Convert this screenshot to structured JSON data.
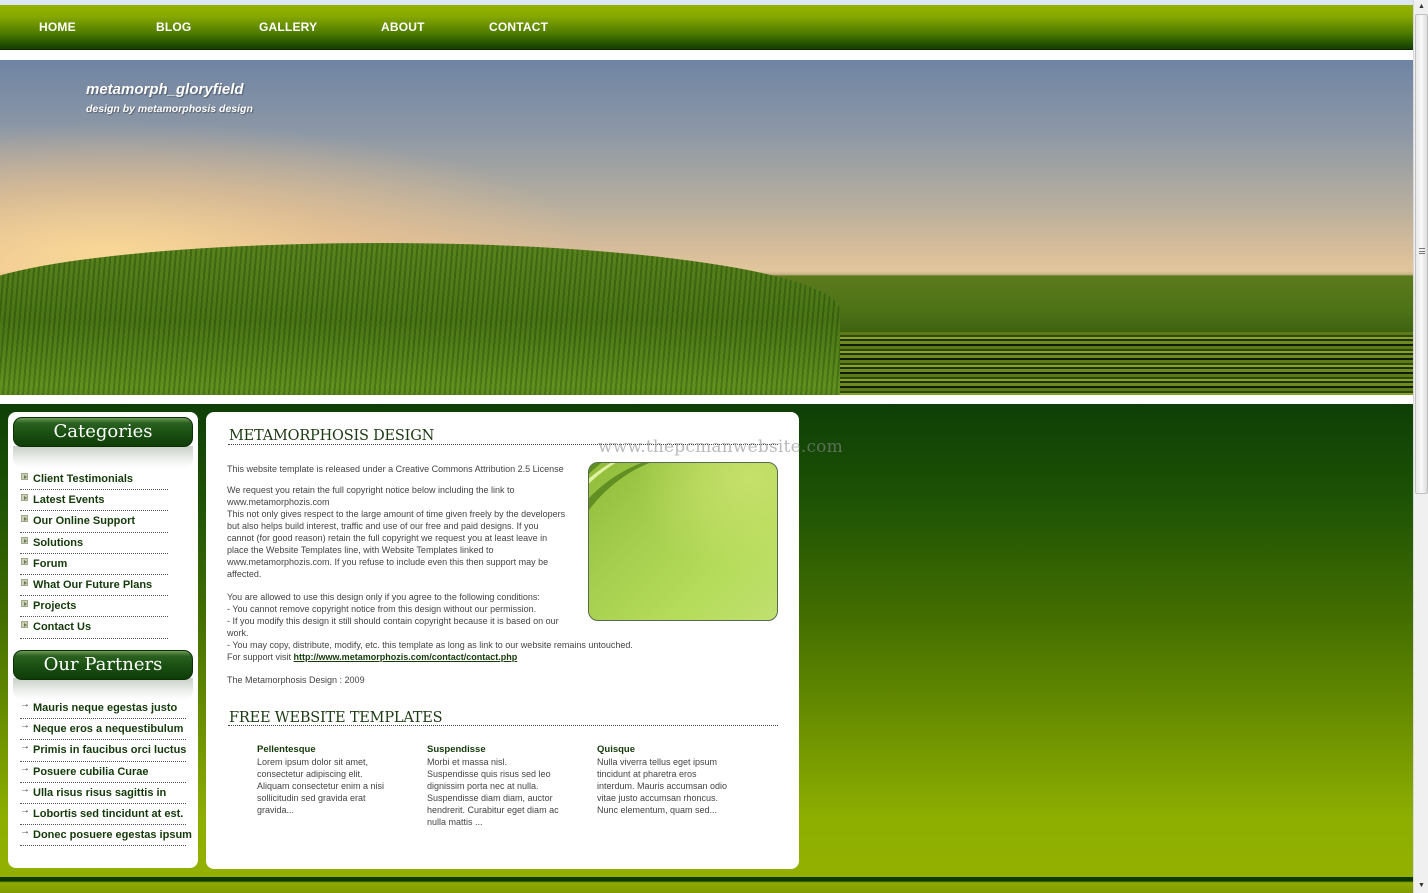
{
  "nav": {
    "items": [
      {
        "label": "HOME"
      },
      {
        "label": "BLOG"
      },
      {
        "label": "GALLERY"
      },
      {
        "label": "ABOUT"
      },
      {
        "label": "CONTACT"
      }
    ]
  },
  "banner": {
    "title": "metamorph_gloryfield",
    "subtitle": "design by metamorphosis design"
  },
  "sidebar": {
    "categories": {
      "heading": "Categories",
      "items": [
        {
          "label": "Client Testimonials",
          "icon": "plus-box-icon"
        },
        {
          "label": "Latest Events",
          "icon": "plus-box-icon"
        },
        {
          "label": "Our Online Support",
          "icon": "plus-box-icon"
        },
        {
          "label": "Solutions",
          "icon": "plus-box-icon"
        },
        {
          "label": "Forum",
          "icon": "plus-box-icon"
        },
        {
          "label": "What Our Future Plans",
          "icon": "plus-box-icon"
        },
        {
          "label": "Projects",
          "icon": "plus-box-icon"
        },
        {
          "label": "Contact Us",
          "icon": "plus-box-icon"
        }
      ]
    },
    "partners": {
      "heading": "Our Partners",
      "items": [
        {
          "label": "Mauris neque egestas justo",
          "icon": "arrow-right-icon"
        },
        {
          "label": "Neque eros a nequestibulum",
          "icon": "arrow-right-icon"
        },
        {
          "label": "Primis in faucibus orci luctus",
          "icon": "arrow-right-icon"
        },
        {
          "label": "Posuere cubilia Curae",
          "icon": "arrow-right-icon"
        },
        {
          "label": "Ulla risus risus sagittis in",
          "icon": "arrow-right-icon"
        },
        {
          "label": "Lobortis sed tincidunt at est.",
          "icon": "arrow-right-icon"
        },
        {
          "label": "Donec posuere egestas ipsum",
          "icon": "arrow-right-icon"
        }
      ]
    }
  },
  "main": {
    "section1": {
      "heading": "METAMORPHOSIS DESIGN",
      "license_line": "This website template is released under a Creative Commons Attribution 2.5 License",
      "request_lines": [
        "We request you retain the full copyright notice below including the link to",
        "www.metamorphozis.com",
        "This not only gives respect to the large amount of time given freely by the developers",
        "but also helps build interest, traffic and use of our free and paid designs. If you",
        "cannot (for good reason) retain the full copyright we request you at least leave in",
        "place the Website Templates line, with Website Templates linked to",
        "www.metamorphozis.com. If you refuse to include even this then support may be",
        "affected."
      ],
      "conditions_lines": [
        "You are allowed to use this design only if you agree to the following conditions:",
        "- You cannot remove copyright notice from this design without our permission.",
        "- If you modify this design it still should contain copyright because it is based on our",
        "work.",
        "- You may copy, distribute, modify, etc. this template as long as link to our website remains untouched."
      ],
      "support_prefix": "For support visit ",
      "support_link": "http://www.metamorphozis.com/contact/contact.php",
      "footer_note": "The Metamorphosis Design : 2009",
      "image_alt": "green abstract swoosh"
    },
    "watermark": "www.thepcmanwebsite.com",
    "section2": {
      "heading": "FREE WEBSITE TEMPLATES",
      "columns": [
        {
          "title": "Pellentesque",
          "lines": [
            "Lorem ipsum dolor sit amet,",
            "consectetur adipiscing elit.",
            "Aliquam consectetur enim a nisi",
            "sollicitudin sed gravida erat",
            "gravida..."
          ]
        },
        {
          "title": "Suspendisse",
          "lines": [
            "Morbi et massa nisl.",
            "Suspendisse quis risus sed leo",
            "dignissim porta nec at nulla.",
            "Suspendisse diam diam, auctor",
            "hendrerit. Curabitur eget diam ac",
            "nulla mattis ..."
          ]
        },
        {
          "title": "Quisque",
          "lines": [
            "Nulla viverra tellus eget ipsum",
            "tincidunt at pharetra eros",
            "interdum. Mauris accumsan odio",
            "vitae justo accumsan rhoncus.",
            "Nunc elementum, quam sed..."
          ]
        }
      ]
    }
  },
  "scrollbar": {
    "up_icon": "▲",
    "down_icon": "▼",
    "position_fraction": 0.0
  },
  "colors": {
    "nav_green_top": "#94b200",
    "nav_green_bottom": "#163d00",
    "link_dark_green": "#143a0a",
    "body_green_top": "#0e3f06",
    "body_green_bottom": "#93b000"
  }
}
